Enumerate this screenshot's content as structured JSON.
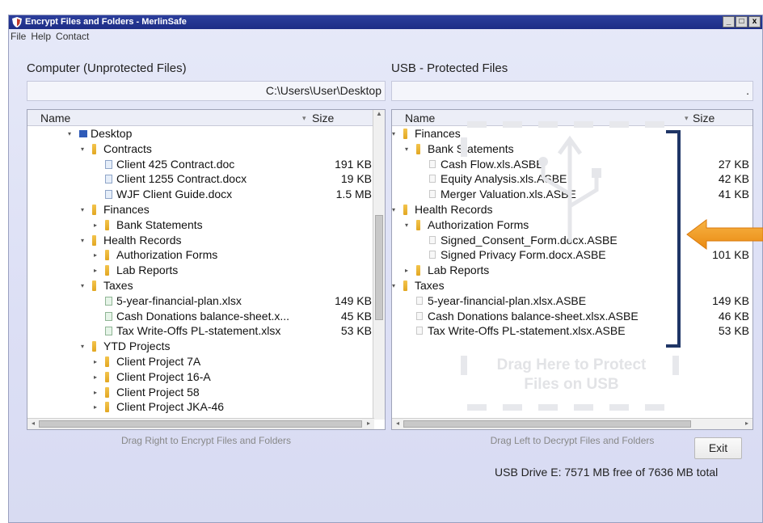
{
  "window": {
    "title": "Encrypt Files and Folders - MerlinSafe",
    "controls": [
      "_",
      "□",
      "x"
    ]
  },
  "menu": [
    "File",
    "Help",
    "Contact"
  ],
  "left_pane": {
    "title": "Computer (Unprotected Files)",
    "path": "C:\\Users\\User\\Desktop",
    "col_name": "Name",
    "col_size": "Size",
    "rows": [
      {
        "label": "Desktop",
        "icon": "drive-icon",
        "size": ""
      },
      {
        "label": "Contracts",
        "icon": "folder-icon",
        "size": ""
      },
      {
        "label": "Client 425 Contract.doc",
        "icon": "docx-file-icon",
        "size": "191 KB"
      },
      {
        "label": "Client 1255 Contract.docx",
        "icon": "docx-file-icon",
        "size": "19 KB"
      },
      {
        "label": "WJF Client Guide.docx",
        "icon": "docx-file-icon",
        "size": "1.5 MB"
      },
      {
        "label": "Finances",
        "icon": "folder-icon",
        "size": ""
      },
      {
        "label": "Bank Statements",
        "icon": "folder-icon",
        "size": ""
      },
      {
        "label": "Health Records",
        "icon": "folder-icon",
        "size": ""
      },
      {
        "label": "Authorization Forms",
        "icon": "folder-icon",
        "size": ""
      },
      {
        "label": "Lab Reports",
        "icon": "folder-icon",
        "size": ""
      },
      {
        "label": "Taxes",
        "icon": "folder-icon",
        "size": ""
      },
      {
        "label": "5-year-financial-plan.xlsx",
        "icon": "xlsx-file-icon",
        "size": "149 KB"
      },
      {
        "label": "Cash Donations balance-sheet.x...",
        "icon": "xlsx-file-icon",
        "size": "45 KB"
      },
      {
        "label": "Tax Write-Offs PL-statement.xlsx",
        "icon": "xlsx-file-icon",
        "size": "53 KB"
      },
      {
        "label": "YTD Projects",
        "icon": "folder-icon",
        "size": ""
      },
      {
        "label": "Client Project 7A",
        "icon": "folder-icon",
        "size": ""
      },
      {
        "label": "Client Project 16-A",
        "icon": "folder-icon",
        "size": ""
      },
      {
        "label": "Client Project 58",
        "icon": "folder-icon",
        "size": ""
      },
      {
        "label": "Client Project JKA-46",
        "icon": "folder-icon",
        "size": ""
      }
    ],
    "hint": "Drag Right to Encrypt Files and Folders"
  },
  "right_pane": {
    "title": "USB - Protected Files",
    "path": ".",
    "col_name": "Name",
    "col_size": "Size",
    "rows": [
      {
        "label": "Finances",
        "icon": "folder-icon",
        "size": ""
      },
      {
        "label": "Bank Statements",
        "icon": "folder-icon",
        "size": ""
      },
      {
        "label": "Cash Flow.xls.ASBE",
        "icon": "asbe-file-icon",
        "size": "27 KB"
      },
      {
        "label": "Equity Analysis.xls.ASBE",
        "icon": "asbe-file-icon",
        "size": "42 KB"
      },
      {
        "label": "Merger Valuation.xls.ASBE",
        "icon": "asbe-file-icon",
        "size": "41 KB"
      },
      {
        "label": "Health Records",
        "icon": "folder-icon",
        "size": ""
      },
      {
        "label": "Authorization Forms",
        "icon": "folder-icon",
        "size": ""
      },
      {
        "label": "Signed_Consent_Form.docx.ASBE",
        "icon": "asbe-file-icon",
        "size": ""
      },
      {
        "label": "Signed Privacy Form.docx.ASBE",
        "icon": "asbe-file-icon",
        "size": "101 KB"
      },
      {
        "label": "Lab Reports",
        "icon": "folder-icon",
        "size": ""
      },
      {
        "label": "Taxes",
        "icon": "folder-icon",
        "size": ""
      },
      {
        "label": "5-year-financial-plan.xlsx.ASBE",
        "icon": "asbe-file-icon",
        "size": "149 KB"
      },
      {
        "label": "Cash Donations balance-sheet.xlsx.ASBE",
        "icon": "asbe-file-icon",
        "size": "46 KB"
      },
      {
        "label": "Tax Write-Offs PL-statement.xlsx.ASBE",
        "icon": "asbe-file-icon",
        "size": "53 KB"
      }
    ],
    "drop_text_line1": "Drag Here to Protect",
    "drop_text_line2": "Files on USB",
    "hint": "Drag Left to Decrypt Files and Folders"
  },
  "exit_label": "Exit",
  "status": "USB Drive E: 7571 MB free of 7636 MB total",
  "colors": {
    "titlebar": "#1d2d86",
    "bracket": "#1f3566",
    "arrow": "#f29a1e",
    "folder": "#e2a722"
  }
}
